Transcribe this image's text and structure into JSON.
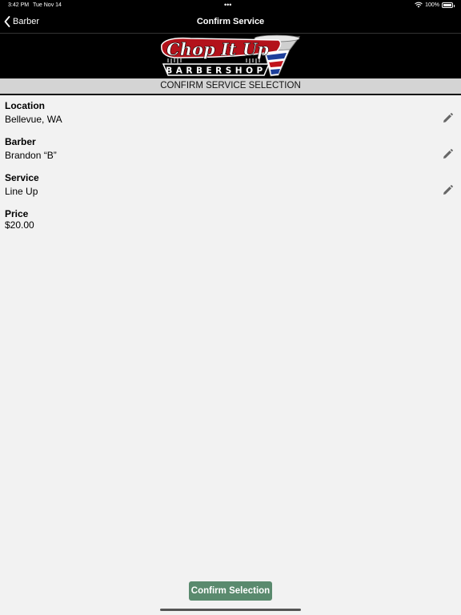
{
  "status": {
    "time": "3:42 PM",
    "date": "Tue Nov 14",
    "battery": "100%"
  },
  "nav": {
    "back_label": "Barber",
    "title": "Confirm Service"
  },
  "logo": {
    "line1": "Chop It Up",
    "line2": "BARBERSHOP"
  },
  "header": {
    "title": "CONFIRM SERVICE SELECTION"
  },
  "details": [
    {
      "label": "Location",
      "value": "Bellevue, WA",
      "editable": true
    },
    {
      "label": "Barber",
      "value": "Brandon “B”",
      "editable": true
    },
    {
      "label": "Service",
      "value": "Line Up",
      "editable": true
    },
    {
      "label": "Price",
      "value": "$20.00",
      "editable": false
    }
  ],
  "actions": {
    "confirm_label": "Confirm Selection"
  },
  "colors": {
    "bar_bg": "#000000",
    "page_bg": "#f2f2f2",
    "header_bg": "#d4d4d4",
    "button_bg": "#5a8a6e",
    "logo_red": "#b3121b"
  },
  "icons": {
    "back": "chevron-left-icon",
    "edit": "pencil-icon",
    "wifi": "wifi-icon",
    "battery": "battery-icon"
  }
}
